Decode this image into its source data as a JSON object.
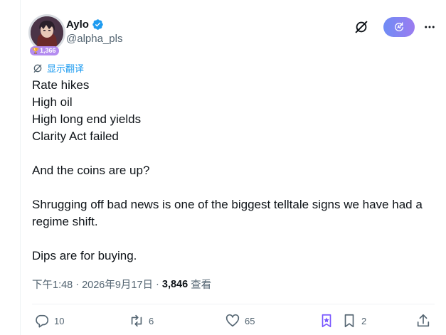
{
  "author": {
    "display_name": "Aylo",
    "handle": "@alpha_pls",
    "badge_count": "1,366",
    "verified": true
  },
  "translate": {
    "label": "显示翻译"
  },
  "tweet": {
    "lines": [
      "Rate hikes",
      "High oil",
      "High long end yields",
      "Clarity Act failed",
      "",
      "And the coins are up?",
      "",
      "Shrugging off bad news is one of the biggest telltale signs we have had a regime shift.",
      "",
      "Dips are for buying."
    ]
  },
  "meta": {
    "time": "下午1:48",
    "date": "2026年9月17日",
    "views_count": "3,846",
    "views_label": "查看",
    "separator": "·"
  },
  "actions": {
    "replies": "10",
    "reposts": "6",
    "likes": "65",
    "bookmarks": "2"
  },
  "colors": {
    "accent": "#1d9bf0",
    "secondary_text": "#536471",
    "primary_text": "#0f1419",
    "badge": "#b48cf0",
    "ai_pill_start": "#6f8cf5",
    "ai_pill_end": "#9b7cf0",
    "bookmark_icon": "#7856ff"
  },
  "icons": {
    "header": [
      "grok-icon",
      "ai-assist-icon",
      "more-icon"
    ],
    "actions": [
      "reply-icon",
      "repost-icon",
      "like-icon",
      "bookmark-special-icon",
      "bookmark-icon",
      "share-icon"
    ]
  }
}
